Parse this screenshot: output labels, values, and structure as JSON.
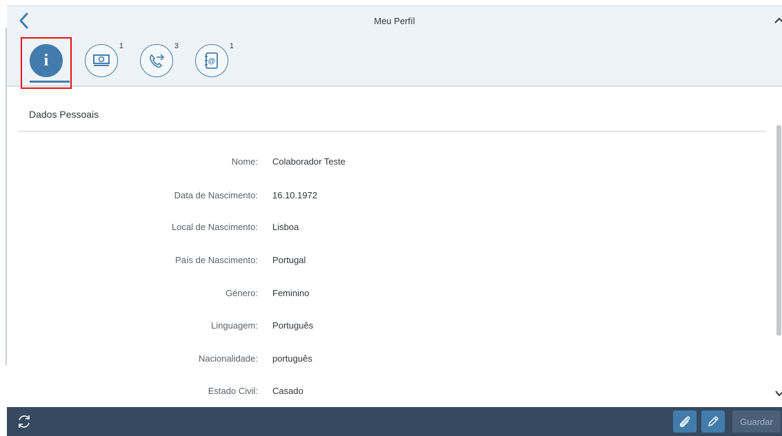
{
  "header": {
    "title": "Meu Perfíl",
    "back_icon": "chevron-left-icon"
  },
  "tabs": [
    {
      "icon": "info-icon",
      "glyph": "i",
      "count": "",
      "selected": true
    },
    {
      "icon": "money-icon",
      "count": "1",
      "selected": false
    },
    {
      "icon": "phone-forward-icon",
      "count": "3",
      "selected": false
    },
    {
      "icon": "address-book-icon",
      "count": "1",
      "selected": false
    }
  ],
  "section": {
    "title": "Dados Pessoais"
  },
  "fields": [
    {
      "label": "Nome:",
      "value": "Colaborador Teste"
    },
    {
      "label": "Data de Nascimento:",
      "value": "16.10.1972"
    },
    {
      "label": "Local de Nascimento:",
      "value": "Lisboa"
    },
    {
      "label": "País de Nascimento:",
      "value": "Portugal"
    },
    {
      "label": "Género:",
      "value": "Feminino"
    },
    {
      "label": "Linguagem:",
      "value": "Português"
    },
    {
      "label": "Nacionalidade:",
      "value": "português"
    },
    {
      "label": "Estado Civil:",
      "value": "Casado"
    }
  ],
  "footer": {
    "refresh_icon": "refresh-icon",
    "attach_icon": "paperclip-icon",
    "edit_icon": "pencil-icon",
    "save_label": "Guardar"
  },
  "colors": {
    "accent": "#427cac",
    "footer_bg": "#354a5f",
    "header_bg": "#eef3f8",
    "highlight": "#e81010"
  }
}
